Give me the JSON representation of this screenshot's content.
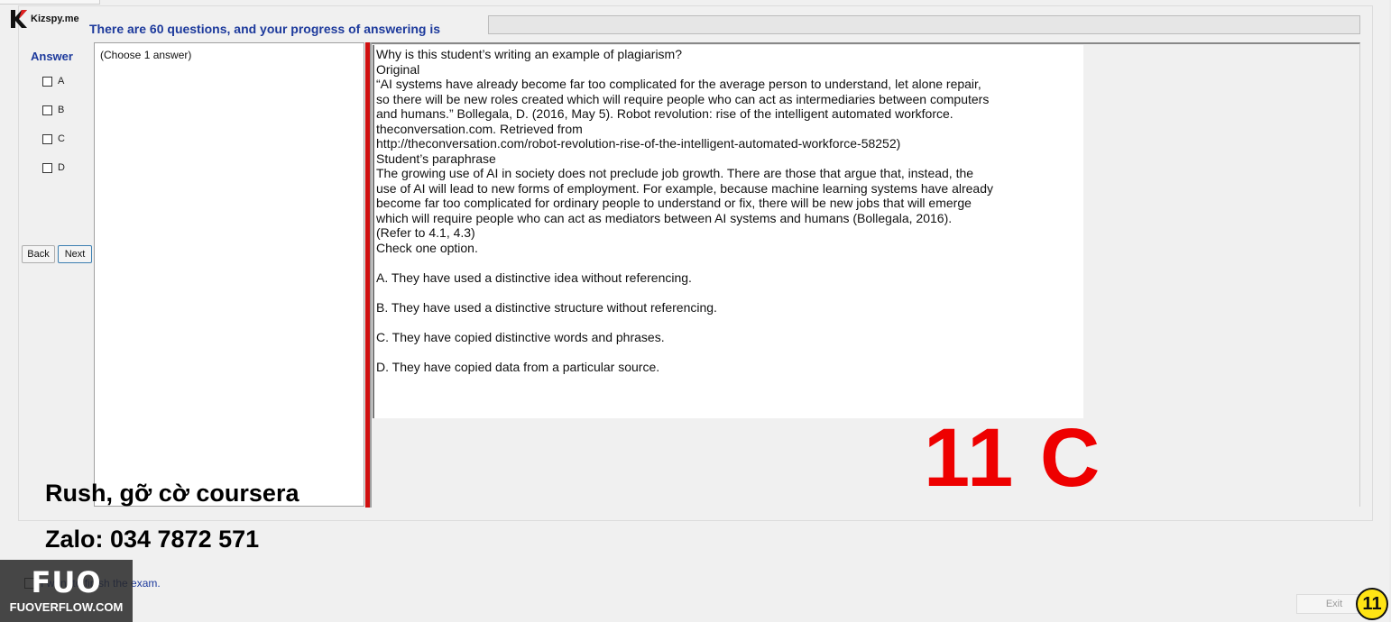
{
  "app": {
    "logo_text": "Kizspy.me"
  },
  "header": {
    "progress_text": "There are 60 questions, and your progress of answering is",
    "progress_fraction": 0
  },
  "answer_panel": {
    "title": "Answer",
    "options": [
      "A",
      "B",
      "C",
      "D"
    ],
    "back_label": "Back",
    "next_label": "Next",
    "hint": "(Choose 1 answer)"
  },
  "question": {
    "lines": [
      "Why is this student’s writing an example of plagiarism?",
      "Original",
      "“AI systems have already become far too complicated for the average person to understand, let alone repair,",
      "so there will be new roles created which will require people who can act as intermediaries between computers",
      "and humans.” Bollegala, D. (2016, May 5). Robot revolution: rise of the intelligent automated workforce.",
      "theconversation.com. Retrieved from",
      "http://theconversation.com/robot-revolution-rise-of-the-intelligent-automated-workforce-58252)",
      "Student’s paraphrase",
      "The growing use of AI in society does not preclude job growth. There are those that argue that, instead, the",
      "use of AI will lead to new forms of employment. For example, because machine learning systems have already",
      "become far too complicated for ordinary people to understand or fix, there will be new jobs that will emerge",
      "which will require people who can act as mediators between AI systems and humans (Bollegala, 2016).",
      "(Refer to 4.1, 4.3)",
      "Check one option."
    ],
    "options": [
      "A.  They have used a distinctive idea without referencing.",
      "B.  They have used a distinctive structure without referencing.",
      "C.  They have copied distinctive words and phrases.",
      "D.  They have copied data from a particular source."
    ]
  },
  "overlay": {
    "answer_mark": "11 C",
    "watermark_line1": "Rush, gỡ cờ coursera",
    "watermark_line2": "Zalo: 034 7872 571",
    "fuo_big": "FUO",
    "fuo_small": "FUOVERFLOW.COM"
  },
  "footer": {
    "finish_label": "I want to finish the exam.",
    "exit_label": "Exit",
    "page_number": "11"
  },
  "colors": {
    "accent_blue": "#1d3a9c",
    "overlay_red": "#ee0000",
    "badge_yellow": "#ffe414",
    "divider_red": "#d01010"
  }
}
